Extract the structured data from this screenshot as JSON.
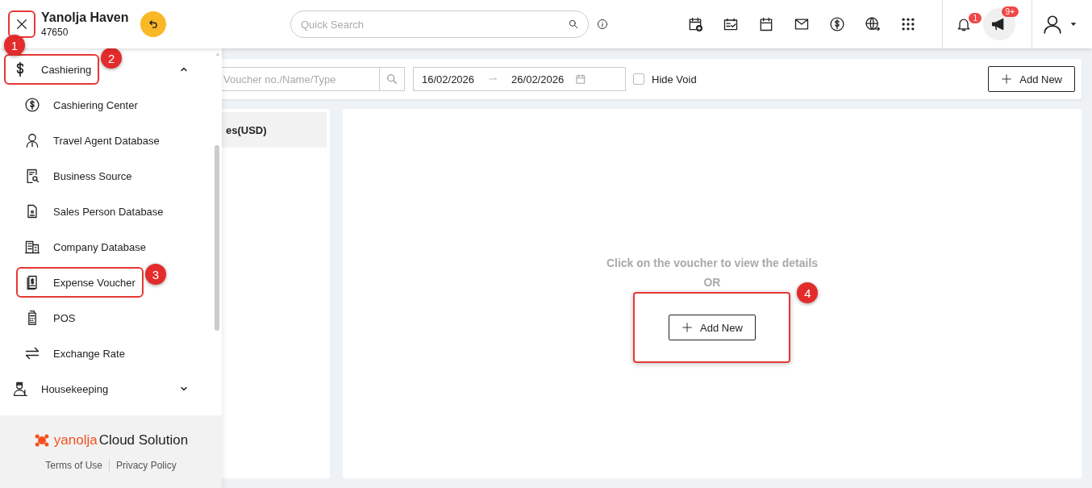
{
  "header": {
    "hotel_name": "Yanolja Haven",
    "hotel_id": "47650",
    "close_callout": "1",
    "search": {
      "placeholder": "Quick Search"
    },
    "notifications": {
      "count": "1"
    },
    "announcements": {
      "count": "9+"
    }
  },
  "sidebar": {
    "groups": [
      {
        "label": "Cashiering",
        "expanded": true,
        "callout": "2",
        "children": [
          {
            "label": "Cashiering Center"
          },
          {
            "label": "Travel Agent Database"
          },
          {
            "label": "Business Source"
          },
          {
            "label": "Sales Person Database"
          },
          {
            "label": "Company Database"
          },
          {
            "label": "Expense Voucher",
            "callout": "3"
          },
          {
            "label": "POS"
          },
          {
            "label": "Exchange Rate"
          }
        ]
      },
      {
        "label": "Housekeeping",
        "expanded": false
      }
    ],
    "brand": {
      "name": "yanolja",
      "suffix": "Cloud Solution"
    },
    "links": [
      "Terms of Use",
      "Privacy Policy"
    ]
  },
  "toolbar": {
    "search": {
      "placeholder": "Voucher no./Name/Type"
    },
    "date_from": "16/02/2026",
    "date_to": "26/02/2026",
    "hide_void": {
      "label": "Hide Void",
      "checked": false
    },
    "add_button": "Add New"
  },
  "list_panel": {
    "header": "es(USD)"
  },
  "detail_panel": {
    "message": "Click on the voucher to view the details",
    "or": "OR",
    "add_button": "Add New",
    "callout": "4"
  }
}
